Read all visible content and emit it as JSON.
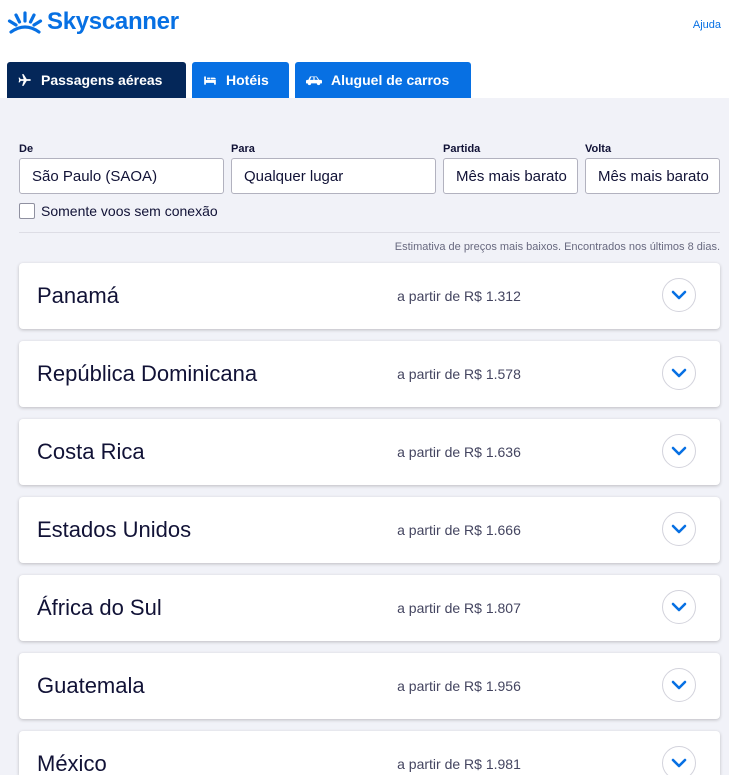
{
  "header": {
    "brand": "Skyscanner",
    "help_label": "Ajuda"
  },
  "tabs": [
    {
      "label": "Passagens aéreas",
      "icon": "airplane-icon",
      "active": true
    },
    {
      "label": "Hotéis",
      "icon": "bed-icon",
      "active": false
    },
    {
      "label": "Aluguel de carros",
      "icon": "car-icon",
      "active": false
    }
  ],
  "search": {
    "from_label": "De",
    "from_value": "São Paulo (SAOA)",
    "to_label": "Para",
    "to_value": "Qualquer lugar",
    "depart_label": "Partida",
    "depart_value": "Mês mais barato",
    "return_label": "Volta",
    "return_value": "Mês mais barato",
    "direct_only_label": "Somente voos sem conexão",
    "direct_only_checked": false
  },
  "estimate_note": "Estimativa de preços mais baixos. Encontrados nos últimos 8 dias.",
  "results": [
    {
      "destination": "Panamá",
      "price": "a partir de R$ 1.312"
    },
    {
      "destination": "República Dominicana",
      "price": "a partir de R$ 1.578"
    },
    {
      "destination": "Costa Rica",
      "price": "a partir de R$ 1.636"
    },
    {
      "destination": "Estados Unidos",
      "price": "a partir de R$ 1.666"
    },
    {
      "destination": "África do Sul",
      "price": "a partir de R$ 1.807"
    },
    {
      "destination": "Guatemala",
      "price": "a partir de R$ 1.956"
    },
    {
      "destination": "México",
      "price": "a partir de R$ 1.981"
    }
  ],
  "colors": {
    "brand_blue": "#0770e3",
    "active_tab": "#042759",
    "panel_bg": "#f1f2f8"
  }
}
